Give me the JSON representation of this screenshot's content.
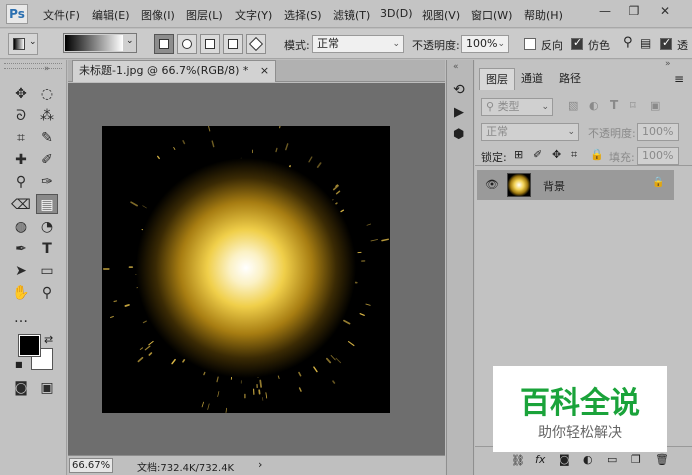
{
  "app": {
    "logo": "Ps"
  },
  "menu": [
    "文件(F)",
    "编辑(E)",
    "图像(I)",
    "图层(L)",
    "文字(Y)",
    "选择(S)",
    "滤镜(T)",
    "3D(D)",
    "视图(V)",
    "窗口(W)",
    "帮助(H)"
  ],
  "window_controls": {
    "minimize": "—",
    "restore": "❐",
    "close": "✕"
  },
  "options": {
    "mode_label": "模式:",
    "mode_value": "正常",
    "opacity_label": "不透明度:",
    "opacity_value": "100%",
    "reverse_label": "反向",
    "reverse_checked": false,
    "dither_label": "仿色",
    "dither_checked": true,
    "transparency_label": "透"
  },
  "document": {
    "tab_title": "未标题-1.jpg @ 66.7%(RGB/8) *",
    "close": "×"
  },
  "status": {
    "zoom": "66.67%",
    "doc_info": "文档:732.4K/732.4K",
    "arrow": "›"
  },
  "panels": {
    "tabs": [
      "图层",
      "通道",
      "路径"
    ],
    "kind_label": "类型",
    "blend_value": "正常",
    "opacity_label": "不透明度:",
    "opacity_value": "100%",
    "lock_label": "锁定:",
    "fill_label": "填充:",
    "fill_value": "100%",
    "layers": [
      {
        "name": "背景",
        "visible": true,
        "locked": true
      }
    ]
  },
  "watermark": {
    "title": "百科全说",
    "subtitle": "助你轻松解决"
  },
  "colors": {
    "accent_green": "#1aa33a",
    "foreground": "#000000",
    "background": "#ffffff"
  }
}
